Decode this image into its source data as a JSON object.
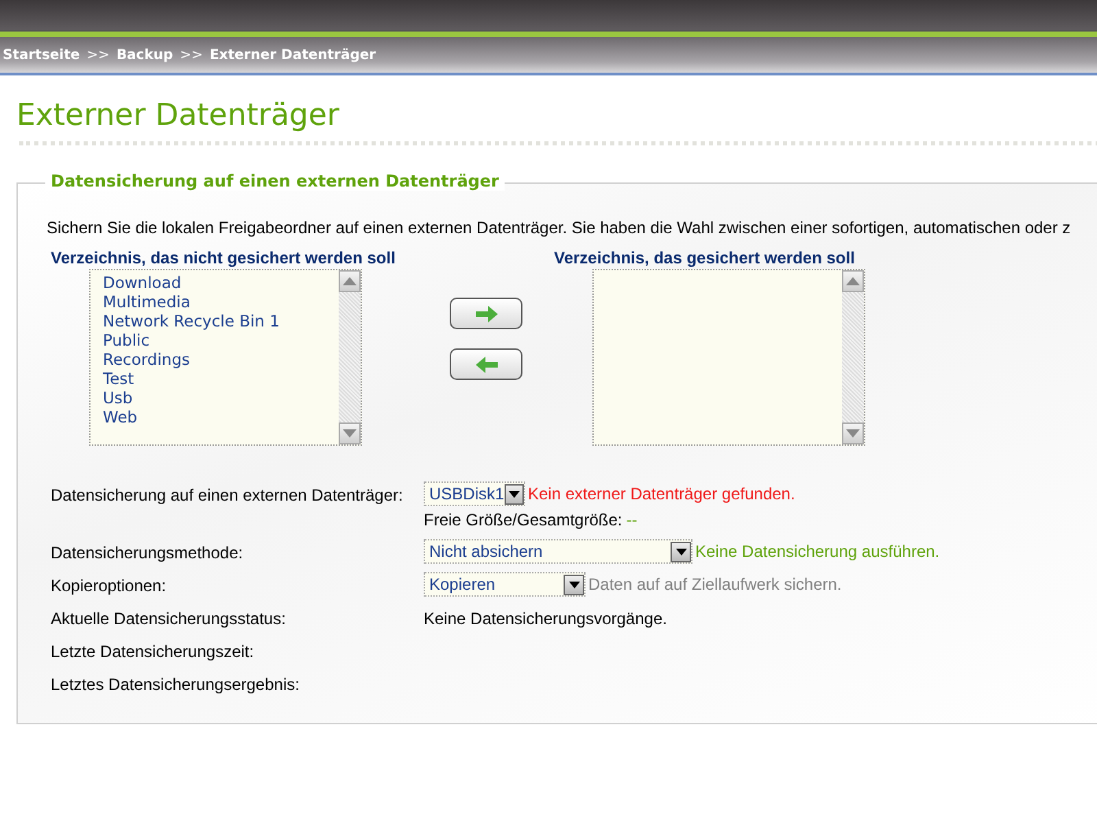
{
  "breadcrumb": [
    {
      "label": "Startseite"
    },
    {
      "label": "Backup"
    },
    {
      "label": "Externer Datenträger"
    }
  ],
  "breadcrumb_separator": ">>",
  "title": "Externer Datenträger",
  "section": {
    "legend": "Datensicherung auf einen externen Datenträger",
    "description": "Sichern Sie die lokalen Freigabeordner auf einen externen Datenträger. Sie haben die Wahl zwischen einer sofortigen, automatischen oder z",
    "source_list": {
      "heading": "Verzeichnis, das nicht gesichert werden soll",
      "items": [
        "Download",
        "Multimedia",
        "Network Recycle Bin 1",
        "Public",
        "Recordings",
        "Test",
        "Usb",
        "Web"
      ]
    },
    "target_list": {
      "heading": "Verzeichnis, das gesichert werden soll"
    },
    "move_buttons": [
      {
        "kind": "add"
      },
      {
        "kind": "remove"
      }
    ],
    "rows": [
      {
        "label": "Datensicherung auf einen externen Datenträger:",
        "select": "USBDisk1",
        "hint": {
          "text": "Kein externer Datenträger gefunden.",
          "kind": "error"
        },
        "sub": {
          "label": "Freie Größe/Gesamtgröße:",
          "value": "--"
        }
      },
      {
        "label": "Datensicherungsmethode:",
        "select": "Nicht absichern",
        "hint": {
          "text": "Keine Datensicherung ausführen.",
          "kind": "ok"
        }
      },
      {
        "label": "Kopieroptionen:",
        "select": "Kopieren",
        "hint": {
          "text": "Daten auf auf Ziellaufwerk sichern.",
          "kind": "info"
        }
      },
      {
        "label": "Aktuelle Datensicherungsstatus:",
        "value": "Keine Datensicherungsvorgänge."
      },
      {
        "label": "Letzte Datensicherungszeit:"
      },
      {
        "label": "Letztes Datensicherungsergebnis:"
      }
    ]
  }
}
